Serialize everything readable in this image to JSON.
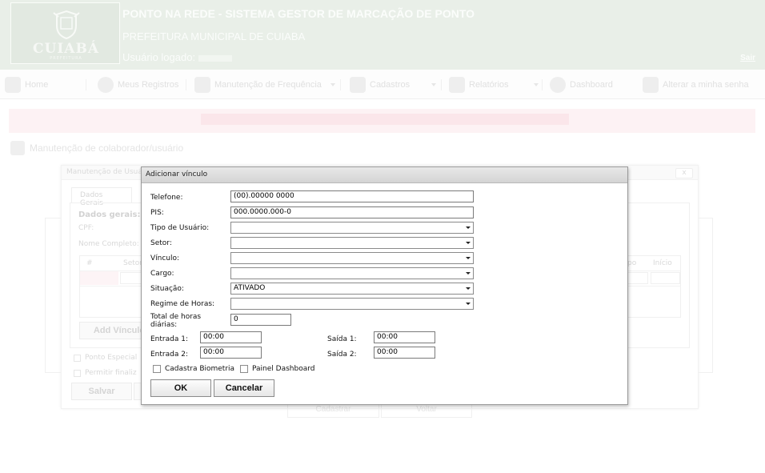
{
  "header": {
    "logo_text": "CUIABÁ",
    "logo_sub": "PREFEITURA",
    "title": "PONTO NA REDE - SISTEMA GESTOR DE MARCAÇÃO DE PONTO",
    "subtitle": "PREFEITURA MUNICIPAL DE CUIABA",
    "user_label": "Usuário logado:",
    "exit": "Sair"
  },
  "nav": {
    "items": [
      {
        "label": "Home",
        "icon": "home-icon"
      },
      {
        "label": "Meus Registros",
        "icon": "check-icon"
      },
      {
        "label": "Manutenção de Frequência",
        "icon": "gears-icon"
      },
      {
        "label": "Cadastros",
        "icon": "building-icon"
      },
      {
        "label": "Relatórios",
        "icon": "report-icon"
      },
      {
        "label": "Dashboard",
        "icon": "pie-chart-icon"
      },
      {
        "label": "Alterar a minha senha",
        "icon": "key-icon"
      }
    ]
  },
  "breadcrumb": "Manutenção de colaborador/usuário",
  "bg_modal": {
    "title": "Manutenção de Usuá",
    "close": "x",
    "tab": "Dados Gerais",
    "section": "Dados gerais:",
    "cpf_label": "CPF:",
    "name_label": "Nome Completo:",
    "table_headers": [
      "#",
      "Setor",
      "po",
      "Início"
    ],
    "add_button": "Add Vínculo",
    "ponto_especial": "Ponto Especial",
    "permitir": "Permitir finaliz",
    "save": "Salvar",
    "cadastrar": "Cadastrar",
    "voltar": "Voltar"
  },
  "dialog": {
    "title": "Adicionar vínculo",
    "fields": {
      "telefone_label": "Telefone:",
      "telefone_value": "(00).00000 0000",
      "pis_label": "PIS:",
      "pis_value": "000.0000.000-0",
      "tipo_label": "Tipo de Usuário:",
      "tipo_value": "",
      "setor_label": "Setor:",
      "setor_value": "",
      "vinculo_label": "Vínculo:",
      "vinculo_value": "",
      "cargo_label": "Cargo:",
      "cargo_value": "",
      "situacao_label": "Situação:",
      "situacao_value": "ATIVADO",
      "regime_label": "Regime de Horas:",
      "regime_value": "",
      "total_label_1": "Total de horas",
      "total_label_2": "diárias:",
      "total_value": "0",
      "entrada1_label": "Entrada 1:",
      "entrada1_value": "00:00",
      "saida1_label": "Saída 1:",
      "saida1_value": "00:00",
      "entrada2_label": "Entrada 2:",
      "entrada2_value": "00:00",
      "saida2_label": "Saída 2:",
      "saida2_value": "00:00"
    },
    "cadastra_biometria": "Cadastra Biometria",
    "painel_dashboard": "Painel Dashboard",
    "ok": "OK",
    "cancel": "Cancelar"
  }
}
